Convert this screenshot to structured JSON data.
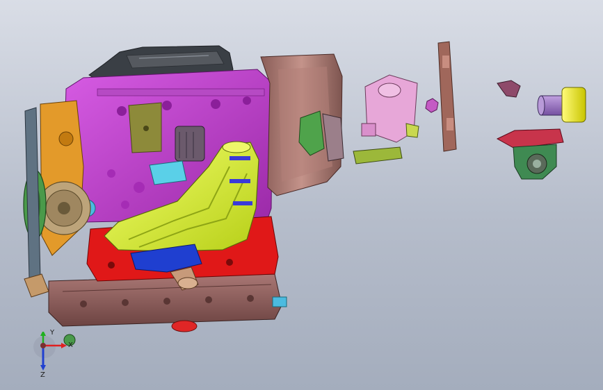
{
  "viewport": {
    "background": {
      "top": "#d9dde6",
      "bottom": "#a4adbd"
    },
    "colors": {
      "block_magenta": "#c23fd2",
      "block_magenta_dark": "#8b1f9a",
      "oil_pan": "#8a5a58",
      "bellhousing": "#9b6f68",
      "intake_manifold": "#d8ef3a",
      "exhaust_red": "#e01818",
      "timing_orange": "#e39a2a",
      "pulley_green": "#4a9a4a",
      "pulley_gray": "#5f7282",
      "valve_cover": "#3a3f45",
      "blue_parts": "#1f3fd0",
      "cyan_parts": "#5ad0e8",
      "pump_pink": "#e7a7d8",
      "bracket_brown": "#a0675b",
      "yellow_cylinder": "#ecec1a",
      "purple_cylinder": "#9c73c6",
      "mount_red": "#c8344b",
      "mount_green": "#3f8a52"
    }
  },
  "triad": {
    "x_label": "X",
    "y_label": "Y",
    "z_label": "Z",
    "colors": {
      "x": "#e02020",
      "y": "#20b020",
      "z": "#2040d0"
    }
  }
}
